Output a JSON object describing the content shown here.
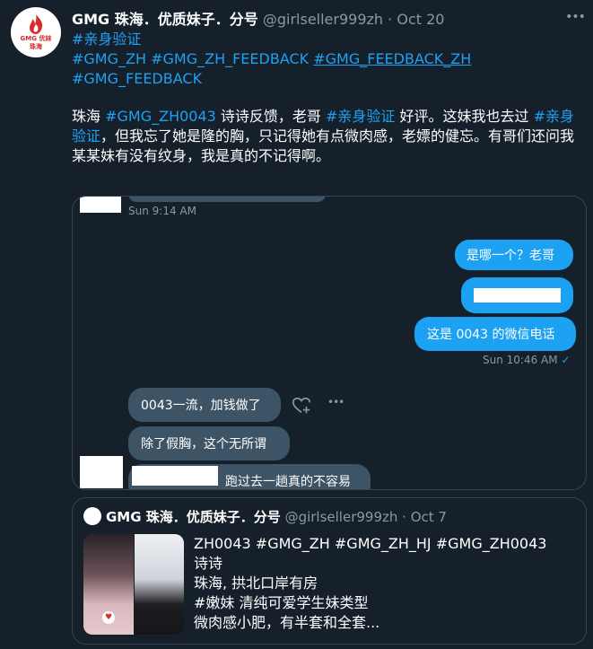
{
  "tweet": {
    "avatar_text_1": "GMG 优妹",
    "avatar_text_2": "珠海",
    "author_name": "GMG 珠海．优质妹子．分号",
    "handle": "@girlseller999zh",
    "separator": "·",
    "date": "Oct 20",
    "more_icon": "more-horizontal-icon",
    "hashtags_line1": [
      "#亲身验证"
    ],
    "hashtags_line2": [
      "#GMG_ZH",
      "#GMG_ZH_FEEDBACK",
      "#GMG_FEEDBACK_ZH"
    ],
    "hashtags_line3": [
      "#GMG_FEEDBACK"
    ],
    "body": {
      "t1": "珠海 ",
      "tag1": "#GMG_ZH0043",
      "t2": " 诗诗反馈，老哥 ",
      "tag2": "#亲身验证",
      "t3": " 好评。这妹我也去过 ",
      "tag3": "#亲身验证",
      "t4": "，但我忘了她是隆的胸，只记得她有点微肉感，老嫖的健忘。有哥们还问我某某妹有没有纹身，我是真的不记得啊。"
    }
  },
  "chat": {
    "ts1": "Sun 9:14 AM",
    "out1": "是哪一个？老哥",
    "out3": "这是 0043 的微信电话",
    "ts2": "Sun 10:46 AM",
    "check": "✓",
    "in1": "0043一流，加钱做了",
    "in2": "除了假胸，这个无所谓",
    "in3": "跑过去一趟真的不容易"
  },
  "quote": {
    "name": "GMG 珠海．优质妹子．分号",
    "handle": "@girlseller999zh",
    "separator": "·",
    "date": "Oct 7",
    "line1": "ZH0043 #GMG_ZH #GMG_ZH_HJ #GMG_ZH0043",
    "line2": "诗诗",
    "line3": "珠海, 拱北口岸有房",
    "line4": "#嫩妹 清纯可爱学生妹类型",
    "line5": "微肉感小肥，有半套和全套..."
  },
  "colors": {
    "background": "#15202b",
    "accent": "#1da1f2",
    "incoming_bubble": "#3d5466",
    "secondary_text": "#8899a6",
    "border": "#38444d"
  }
}
